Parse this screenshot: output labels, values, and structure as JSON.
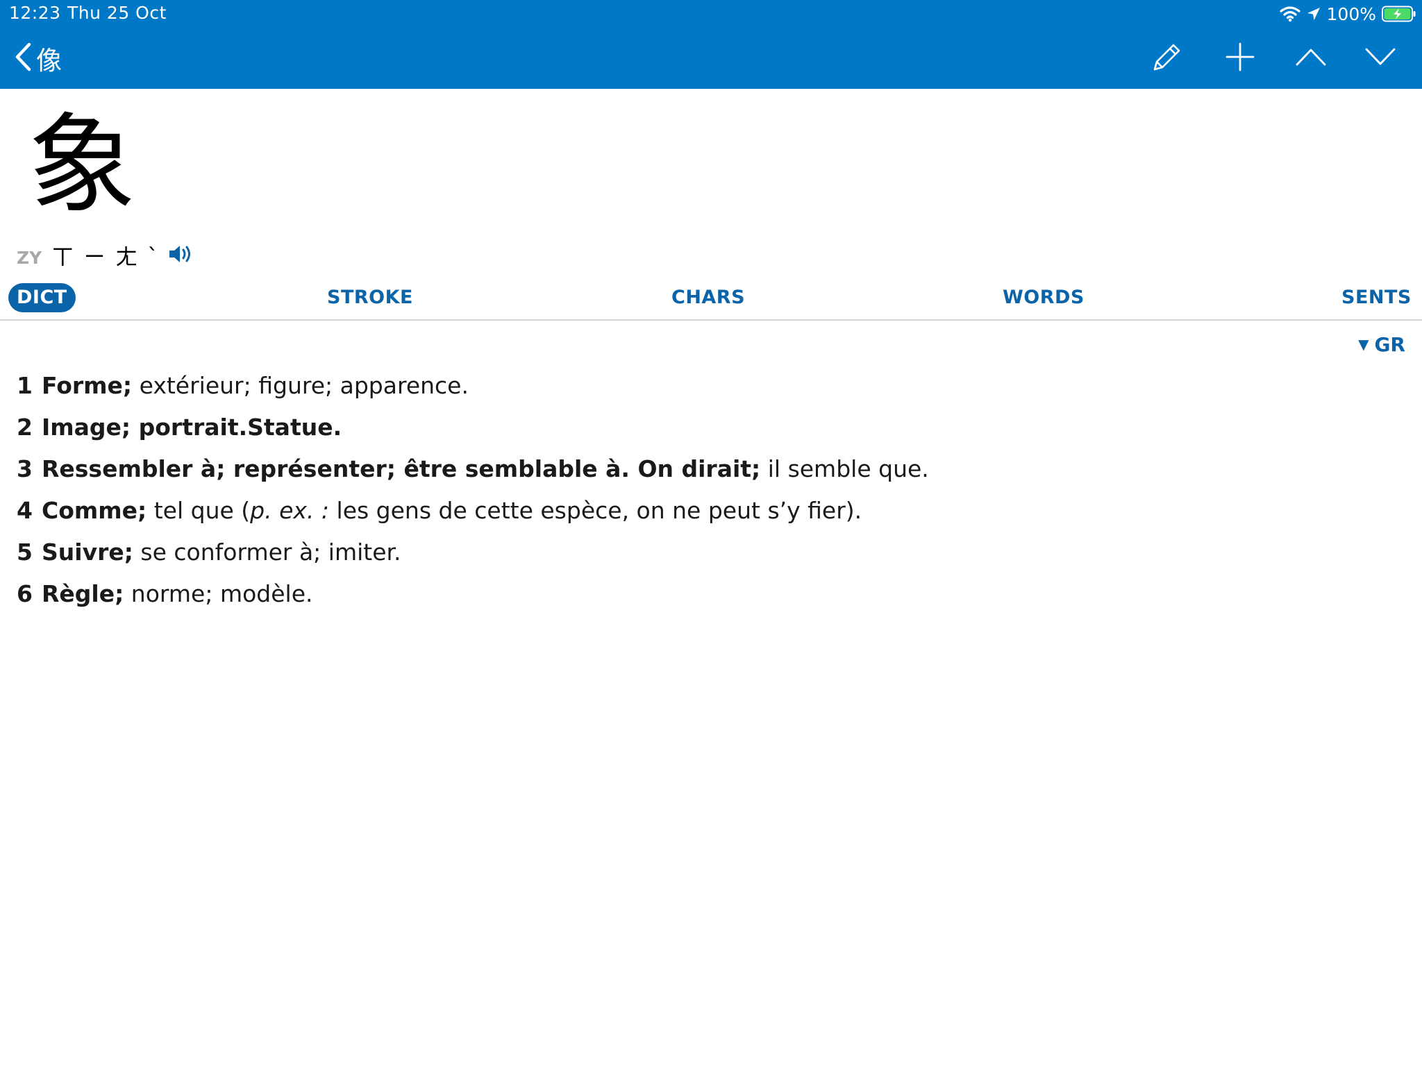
{
  "status_bar": {
    "time": "12:23",
    "date": "Thu 25 Oct",
    "battery_percent": "100%",
    "battery_level": 1.0,
    "icons": [
      "wifi-icon",
      "location-arrow-icon",
      "battery-charging-icon"
    ]
  },
  "nav": {
    "back_label": "像",
    "back_icon": "chevron-left-icon",
    "actions": [
      "pencil-icon",
      "plus-icon",
      "chevron-up-icon",
      "chevron-down-icon"
    ]
  },
  "entry": {
    "headword": "象",
    "pron_label": "ZY",
    "pron_text": "ㄒㄧㄤˋ",
    "speaker_icon": "speaker-icon"
  },
  "tabs": [
    {
      "label": "DICT",
      "active": true
    },
    {
      "label": "STROKE",
      "active": false
    },
    {
      "label": "CHARS",
      "active": false
    },
    {
      "label": "WORDS",
      "active": false
    },
    {
      "label": "SENTS",
      "active": false
    }
  ],
  "filter": {
    "triangle": "▼",
    "label": "GR"
  },
  "definitions": [
    {
      "num": "1",
      "parts": [
        {
          "text": "Forme;",
          "style": "b"
        },
        {
          "text": " extérieur; figure; apparence.",
          "style": ""
        }
      ]
    },
    {
      "num": "2",
      "parts": [
        {
          "text": "Image; portrait.Statue.",
          "style": "b"
        }
      ]
    },
    {
      "num": "3",
      "parts": [
        {
          "text": "Ressembler à; représenter; être semblable à. On dirait;",
          "style": "b"
        },
        {
          "text": " il semble que.",
          "style": ""
        }
      ]
    },
    {
      "num": "4",
      "parts": [
        {
          "text": "Comme;",
          "style": "b"
        },
        {
          "text": " tel que (",
          "style": ""
        },
        {
          "text": "p. ex. :",
          "style": "i"
        },
        {
          "text": " les gens de cette espèce, on ne peut s’y fier).",
          "style": ""
        }
      ]
    },
    {
      "num": "5",
      "parts": [
        {
          "text": "Suivre;",
          "style": "b"
        },
        {
          "text": " se conformer à; imiter.",
          "style": ""
        }
      ]
    },
    {
      "num": "6",
      "parts": [
        {
          "text": "Règle;",
          "style": "b"
        },
        {
          "text": " norme; modèle.",
          "style": ""
        }
      ]
    }
  ],
  "colors": {
    "header_bg": "#0078c8",
    "accent": "#0b63a8",
    "battery_fill": "#4cd964"
  }
}
